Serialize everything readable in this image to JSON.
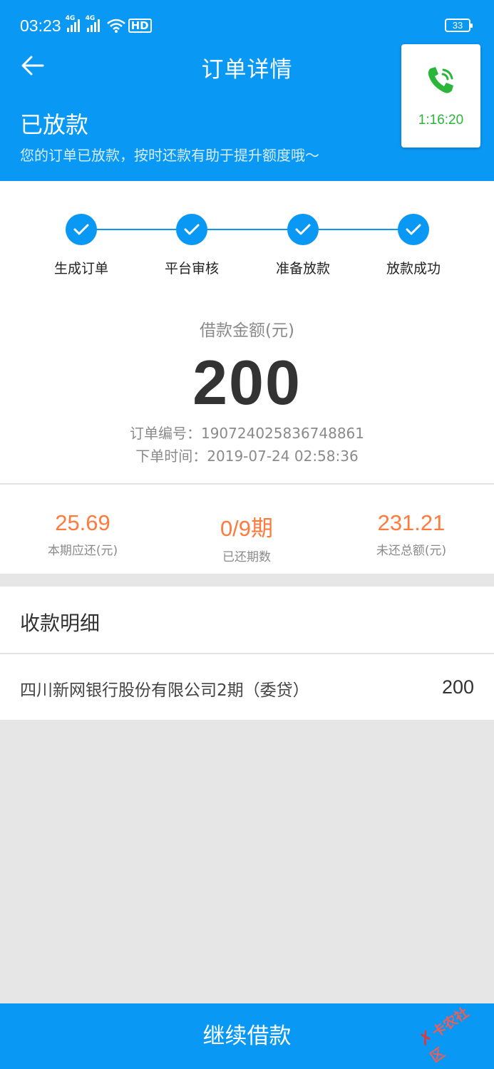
{
  "status_bar": {
    "time": "03:23",
    "battery": "33"
  },
  "nav": {
    "title": "订单详情"
  },
  "order_status": {
    "title": "已放款",
    "subtitle": "您的订单已放款，按时还款有助于提升额度哦～"
  },
  "call_widget": {
    "timer": "1:16:20"
  },
  "steps": [
    {
      "label": "生成订单"
    },
    {
      "label": "平台审核"
    },
    {
      "label": "准备放款"
    },
    {
      "label": "放款成功"
    }
  ],
  "loan": {
    "amount_label": "借款金额(元)",
    "amount": "200",
    "order_no": "订单编号：190724025836748861",
    "order_time": "下单时间：2019-07-24 02:58:36"
  },
  "stats": [
    {
      "value": "25.69",
      "label": "本期应还(元)"
    },
    {
      "value": "0/9期",
      "label": "已还期数"
    },
    {
      "value": "231.21",
      "label": "未还总额(元)"
    }
  ],
  "receipt": {
    "title": "收款明细",
    "name": "四川新网银行股份有限公司2期（委贷）",
    "amount": "200"
  },
  "cta": {
    "label": "继续借款"
  },
  "watermark": {
    "text": "卡农社区"
  },
  "colors": {
    "primary": "#0a98f5",
    "accent": "#ff7a3d",
    "call": "#2bb53b"
  }
}
